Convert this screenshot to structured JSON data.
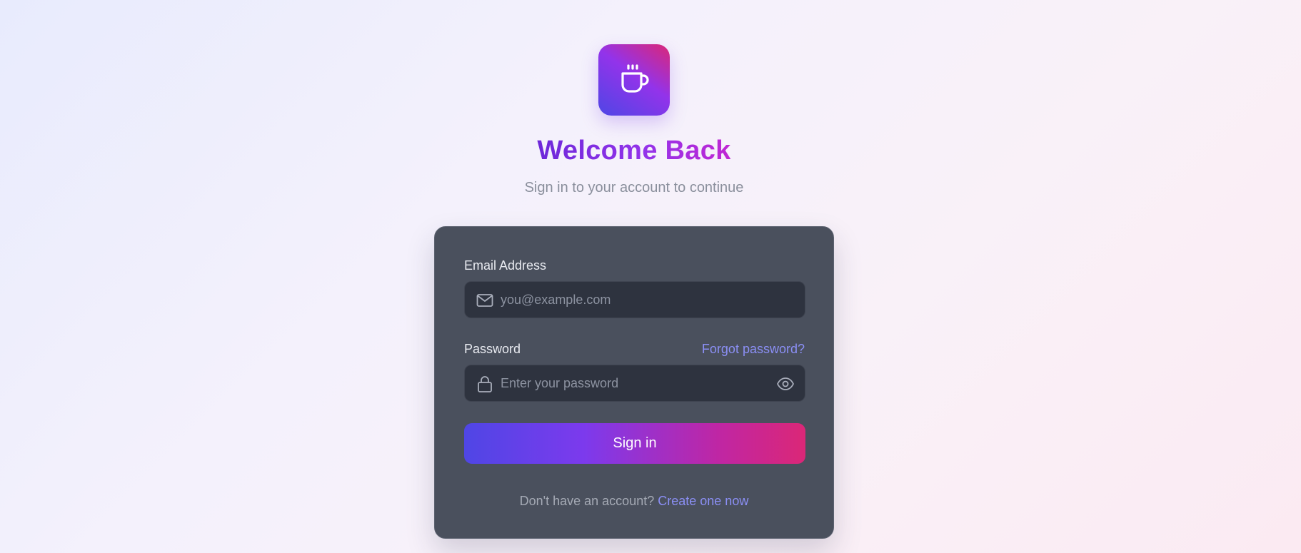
{
  "header": {
    "logo_icon": "coffee-cup-icon",
    "title": "Welcome Back",
    "subtitle": "Sign in to your account to continue"
  },
  "form": {
    "email": {
      "label": "Email Address",
      "placeholder": "you@example.com",
      "value": "",
      "icon": "mail-icon"
    },
    "password": {
      "label": "Password",
      "placeholder": "Enter your password",
      "value": "",
      "icon": "lock-icon",
      "toggle_icon": "eye-icon",
      "forgot_label": "Forgot password?"
    },
    "submit_label": "Sign in"
  },
  "footer": {
    "prompt": "Don't have an account?",
    "create_label": "Create one now"
  },
  "colors": {
    "accent_start": "#4f46e5",
    "accent_mid": "#9333ea",
    "accent_end": "#db2777",
    "card_bg": "#4a505d",
    "link": "#8b8ff5"
  }
}
